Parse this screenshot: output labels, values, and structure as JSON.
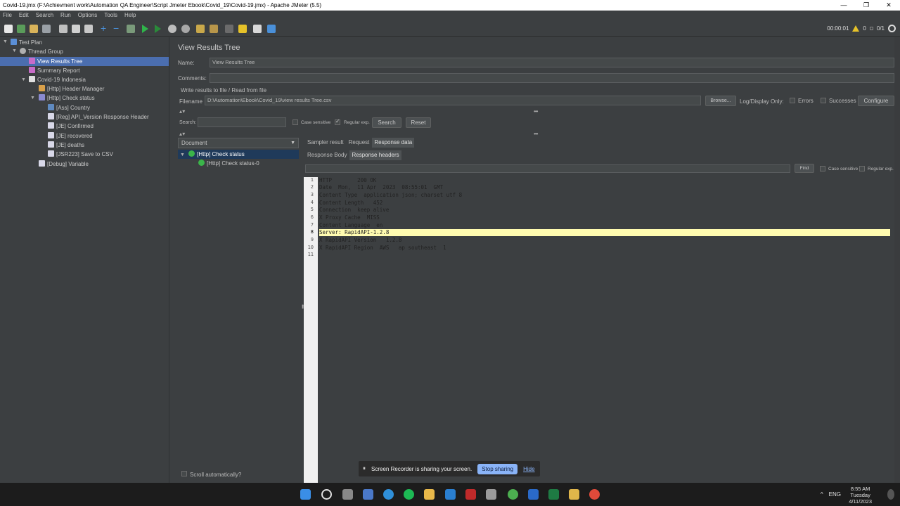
{
  "window": {
    "title": "Covid-19.jmx (F:\\Achievment work\\Automation QA Engineer\\Script Jmeter Ebook\\Covid_19\\Covid-19.jmx) - Apache JMeter (5.5)",
    "minimize": "—",
    "restore": "❐",
    "close": "✕"
  },
  "menu": [
    "File",
    "Edit",
    "Search",
    "Run",
    "Options",
    "Tools",
    "Help"
  ],
  "toolbar": {
    "timer": "00:00:01",
    "warnings": "0",
    "threads": "0/1"
  },
  "tree": {
    "test_plan": "Test Plan",
    "thread_group": "Thread Group",
    "view_results_tree": "View Results Tree",
    "summary_report": "Summary Report",
    "covid_indonesia": "Covid-19 Indonesia",
    "header_manager": "[Http] Header Manager",
    "check_status": "[Http] Check status",
    "ass_country": "[Ass] Country",
    "reg_api_version": "[Reg] API_Version Response Header",
    "je_confirmed": "[JE] Confirmed",
    "je_recovered": "[JE] recovered",
    "je_deaths": "[JE] deaths",
    "jsr_save": "[JSR223] Save to CSV",
    "debug_variable": "[Debug] Variable"
  },
  "panel": {
    "title": "View Results Tree",
    "name_label": "Name:",
    "name_value": "View Results Tree",
    "comments_label": "Comments:",
    "write_results": "Write results to file / Read from file",
    "filename_label": "Filename",
    "filename_value": "D:\\Automation\\Ebook\\Covid_19\\view results Tree.csv",
    "browse": "Browse...",
    "log_display": "Log/Display Only:",
    "errors": "Errors",
    "successes": "Successes",
    "configure": "Configure",
    "search_label": "Search:",
    "case_sensitive": "Case sensitive",
    "regular_exp": "Regular exp.",
    "search_btn": "Search",
    "reset_btn": "Reset",
    "renderer": "Document",
    "result_parent": "[Http] Check status",
    "result_child": "[Http] Check status-0",
    "scroll_auto": "Scroll automatically?"
  },
  "tabs": {
    "sampler_result": "Sampler result",
    "request": "Request",
    "response_data": "Response data",
    "response_body": "Response Body",
    "response_headers": "Response headers",
    "find": "Find",
    "case_sensitive": "Case sensitive",
    "regular_exp": "Regular exp."
  },
  "response_lines": [
    {
      "n": "1",
      "text": "HTTP        200 OK"
    },
    {
      "n": "2",
      "text": "Date  Mon,  11 Apr  2023  08:55:01  GMT"
    },
    {
      "n": "3",
      "text": "Content Type  application json; charset utf 8"
    },
    {
      "n": "4",
      "text": "Content Length   452"
    },
    {
      "n": "5",
      "text": "Connection  keep alive"
    },
    {
      "n": "6",
      "text": "X Proxy Cache  MISS"
    },
    {
      "n": "7",
      "text": "Content Language  en"
    },
    {
      "n": "8",
      "text": "Server: RapidAPI-1.2.8"
    },
    {
      "n": "9",
      "text": "X RapidAPI Version   1.2.8"
    },
    {
      "n": "10",
      "text": "X RapidAPI Region  AWS   ap southeast  1"
    },
    {
      "n": "11",
      "text": ""
    }
  ],
  "share_bar": {
    "message": "Screen Recorder is sharing your screen.",
    "stop": "Stop sharing",
    "hide": "Hide"
  },
  "taskbar": {
    "lang": "ENG",
    "time": "8:55 AM",
    "day": "Tuesday",
    "date": "4/11/2023"
  }
}
